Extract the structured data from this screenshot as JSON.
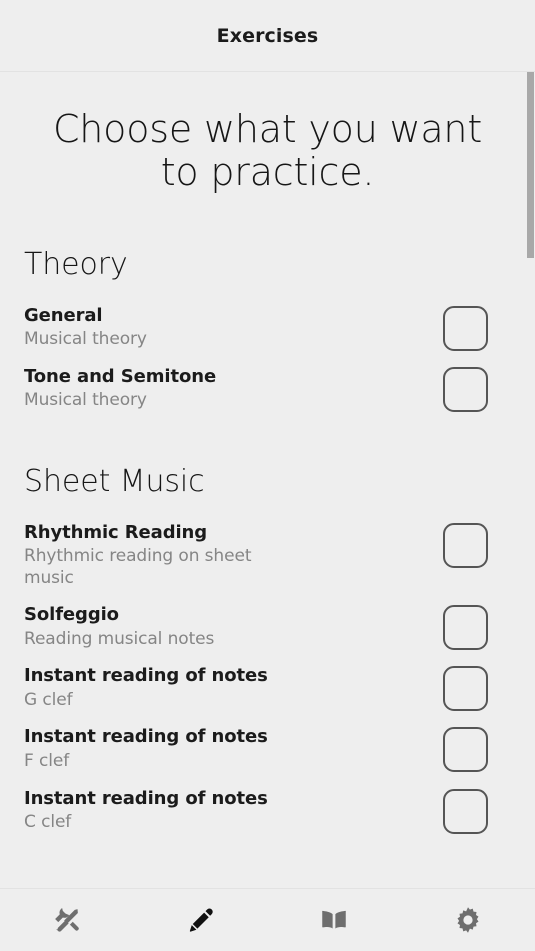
{
  "header": {
    "title": "Exercises"
  },
  "main": {
    "heading": "Choose what you want to practice.",
    "sections": [
      {
        "title": "Theory",
        "items": [
          {
            "title": "General",
            "subtitle": "Musical theory",
            "checked": false
          },
          {
            "title": "Tone and Semitone",
            "subtitle": "Musical theory",
            "checked": false
          }
        ]
      },
      {
        "title": "Sheet Music",
        "items": [
          {
            "title": "Rhythmic Reading",
            "subtitle": "Rhythmic reading on sheet music",
            "checked": false
          },
          {
            "title": "Solfeggio",
            "subtitle": "Reading musical notes",
            "checked": false
          },
          {
            "title": "Instant reading of notes",
            "subtitle": "G clef",
            "checked": false
          },
          {
            "title": "Instant reading of notes",
            "subtitle": "F clef",
            "checked": false
          },
          {
            "title": "Instant reading of notes",
            "subtitle": "C clef",
            "checked": false
          }
        ]
      }
    ]
  },
  "tabbar": {
    "tabs": [
      {
        "icon": "tools-icon",
        "active": false
      },
      {
        "icon": "pencil-icon",
        "active": true
      },
      {
        "icon": "book-icon",
        "active": false
      },
      {
        "icon": "gear-icon",
        "active": false
      }
    ]
  },
  "colors": {
    "background": "#eeeeee",
    "text_primary": "#1b1b1b",
    "text_secondary": "#858585",
    "checkbox_border": "#555555",
    "icon_inactive": "#6e6e6e",
    "icon_active": "#111111",
    "scrollbar_thumb": "#a8a8a8",
    "divider": "#e2e2e2"
  },
  "scrollbar": {
    "thumb_top": 0,
    "thumb_height": 186
  }
}
